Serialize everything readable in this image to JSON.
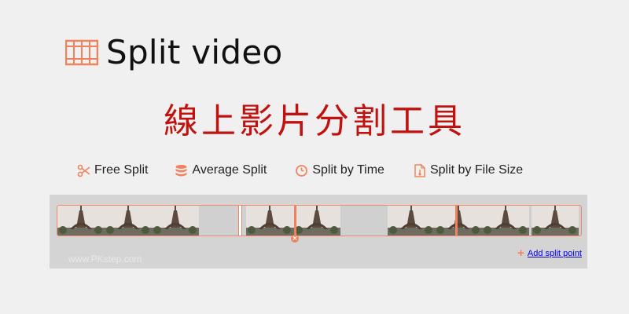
{
  "header": {
    "title": "Split video",
    "icon": "film-strip-icon"
  },
  "subtitle": "線上影片分割工具",
  "modes": [
    {
      "label": "Free Split",
      "icon": "scissors-icon"
    },
    {
      "label": "Average Split",
      "icon": "database-stack-icon"
    },
    {
      "label": "Split by Time",
      "icon": "clock-icon"
    },
    {
      "label": "Split by File Size",
      "icon": "file-size-icon"
    }
  ],
  "timeline": {
    "accent_color": "#f0835e",
    "add_split_label": "Add split point",
    "watermark": "www.PKstep.com"
  }
}
